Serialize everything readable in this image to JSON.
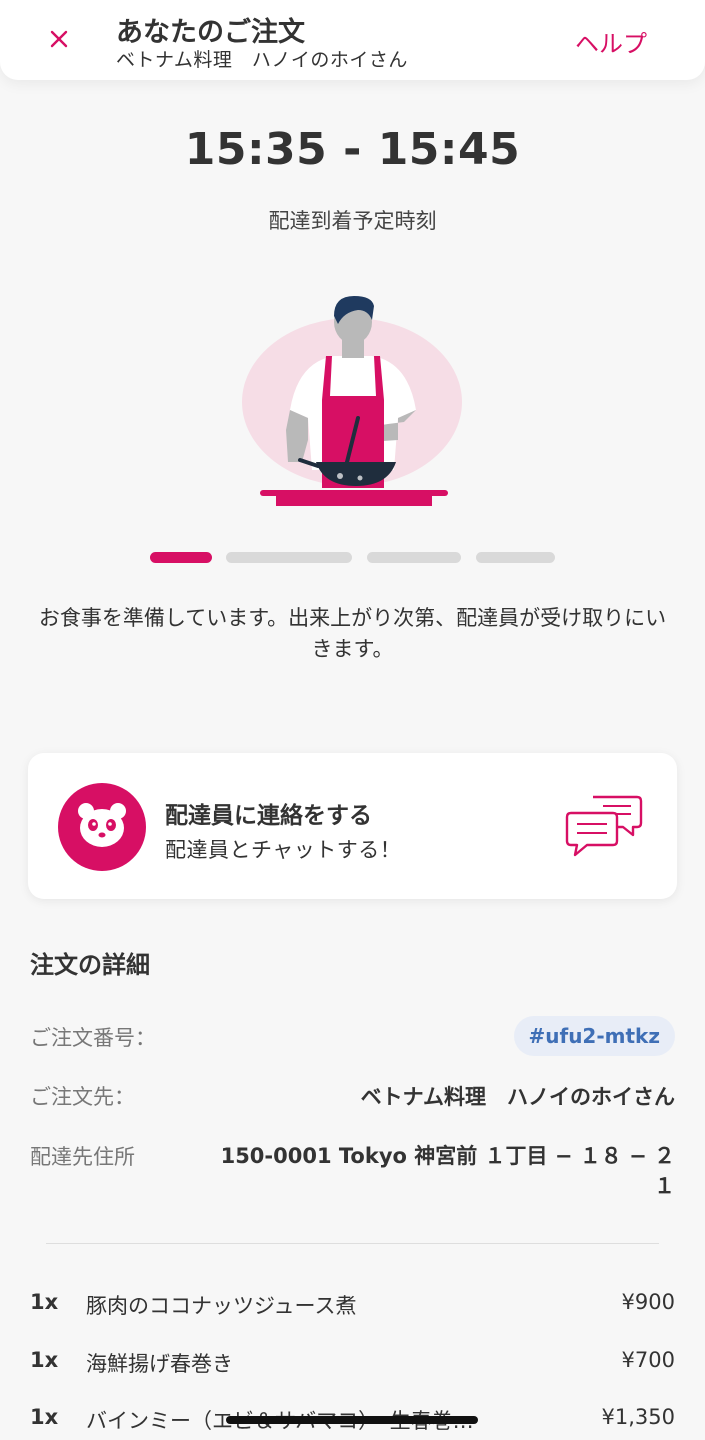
{
  "header": {
    "title": "あなたのご注文",
    "subtitle": "ベトナム料理　ハノイのホイさん",
    "help_label": "ヘルプ",
    "close_icon": "close-icon"
  },
  "delivery": {
    "time_range": "15:35 - 15:45",
    "time_label": "配達到着予定時刻"
  },
  "progress": {
    "current_step": 1,
    "total_steps": 4
  },
  "status_message": "お食事を準備しています。出来上がり次第、配達員が受け取りにいきます。",
  "contact_card": {
    "title": "配達員に連絡をする",
    "subtitle": "配達員とチャットする！",
    "avatar_icon": "panda-icon",
    "chat_icon": "chat-bubbles-icon"
  },
  "order_details": {
    "section_title": "注文の詳細",
    "order_number_label": "ご注文番号：",
    "order_number": "#ufu2-mtkz",
    "restaurant_label": "ご注文先：",
    "restaurant": "ベトナム料理　ハノイのホイさん",
    "address_label": "配達先住所",
    "address": "150-0001 Tokyo 神宮前 １丁目 − １８ − ２１"
  },
  "items": [
    {
      "qty": "1x",
      "name": "豚肉のココナッツジュース煮",
      "price": "¥900"
    },
    {
      "qty": "1x",
      "name": "海鮮揚げ春巻き",
      "price": "¥700"
    },
    {
      "qty": "1x",
      "name": "バインミー（エビ＆サバマコ）　生春巻…",
      "price": "¥1,350"
    }
  ],
  "colors": {
    "accent": "#d70f64",
    "progress_inactive": "#d9d9d9",
    "badge_bg": "#e8edf7",
    "badge_text": "#3f6fb6"
  }
}
